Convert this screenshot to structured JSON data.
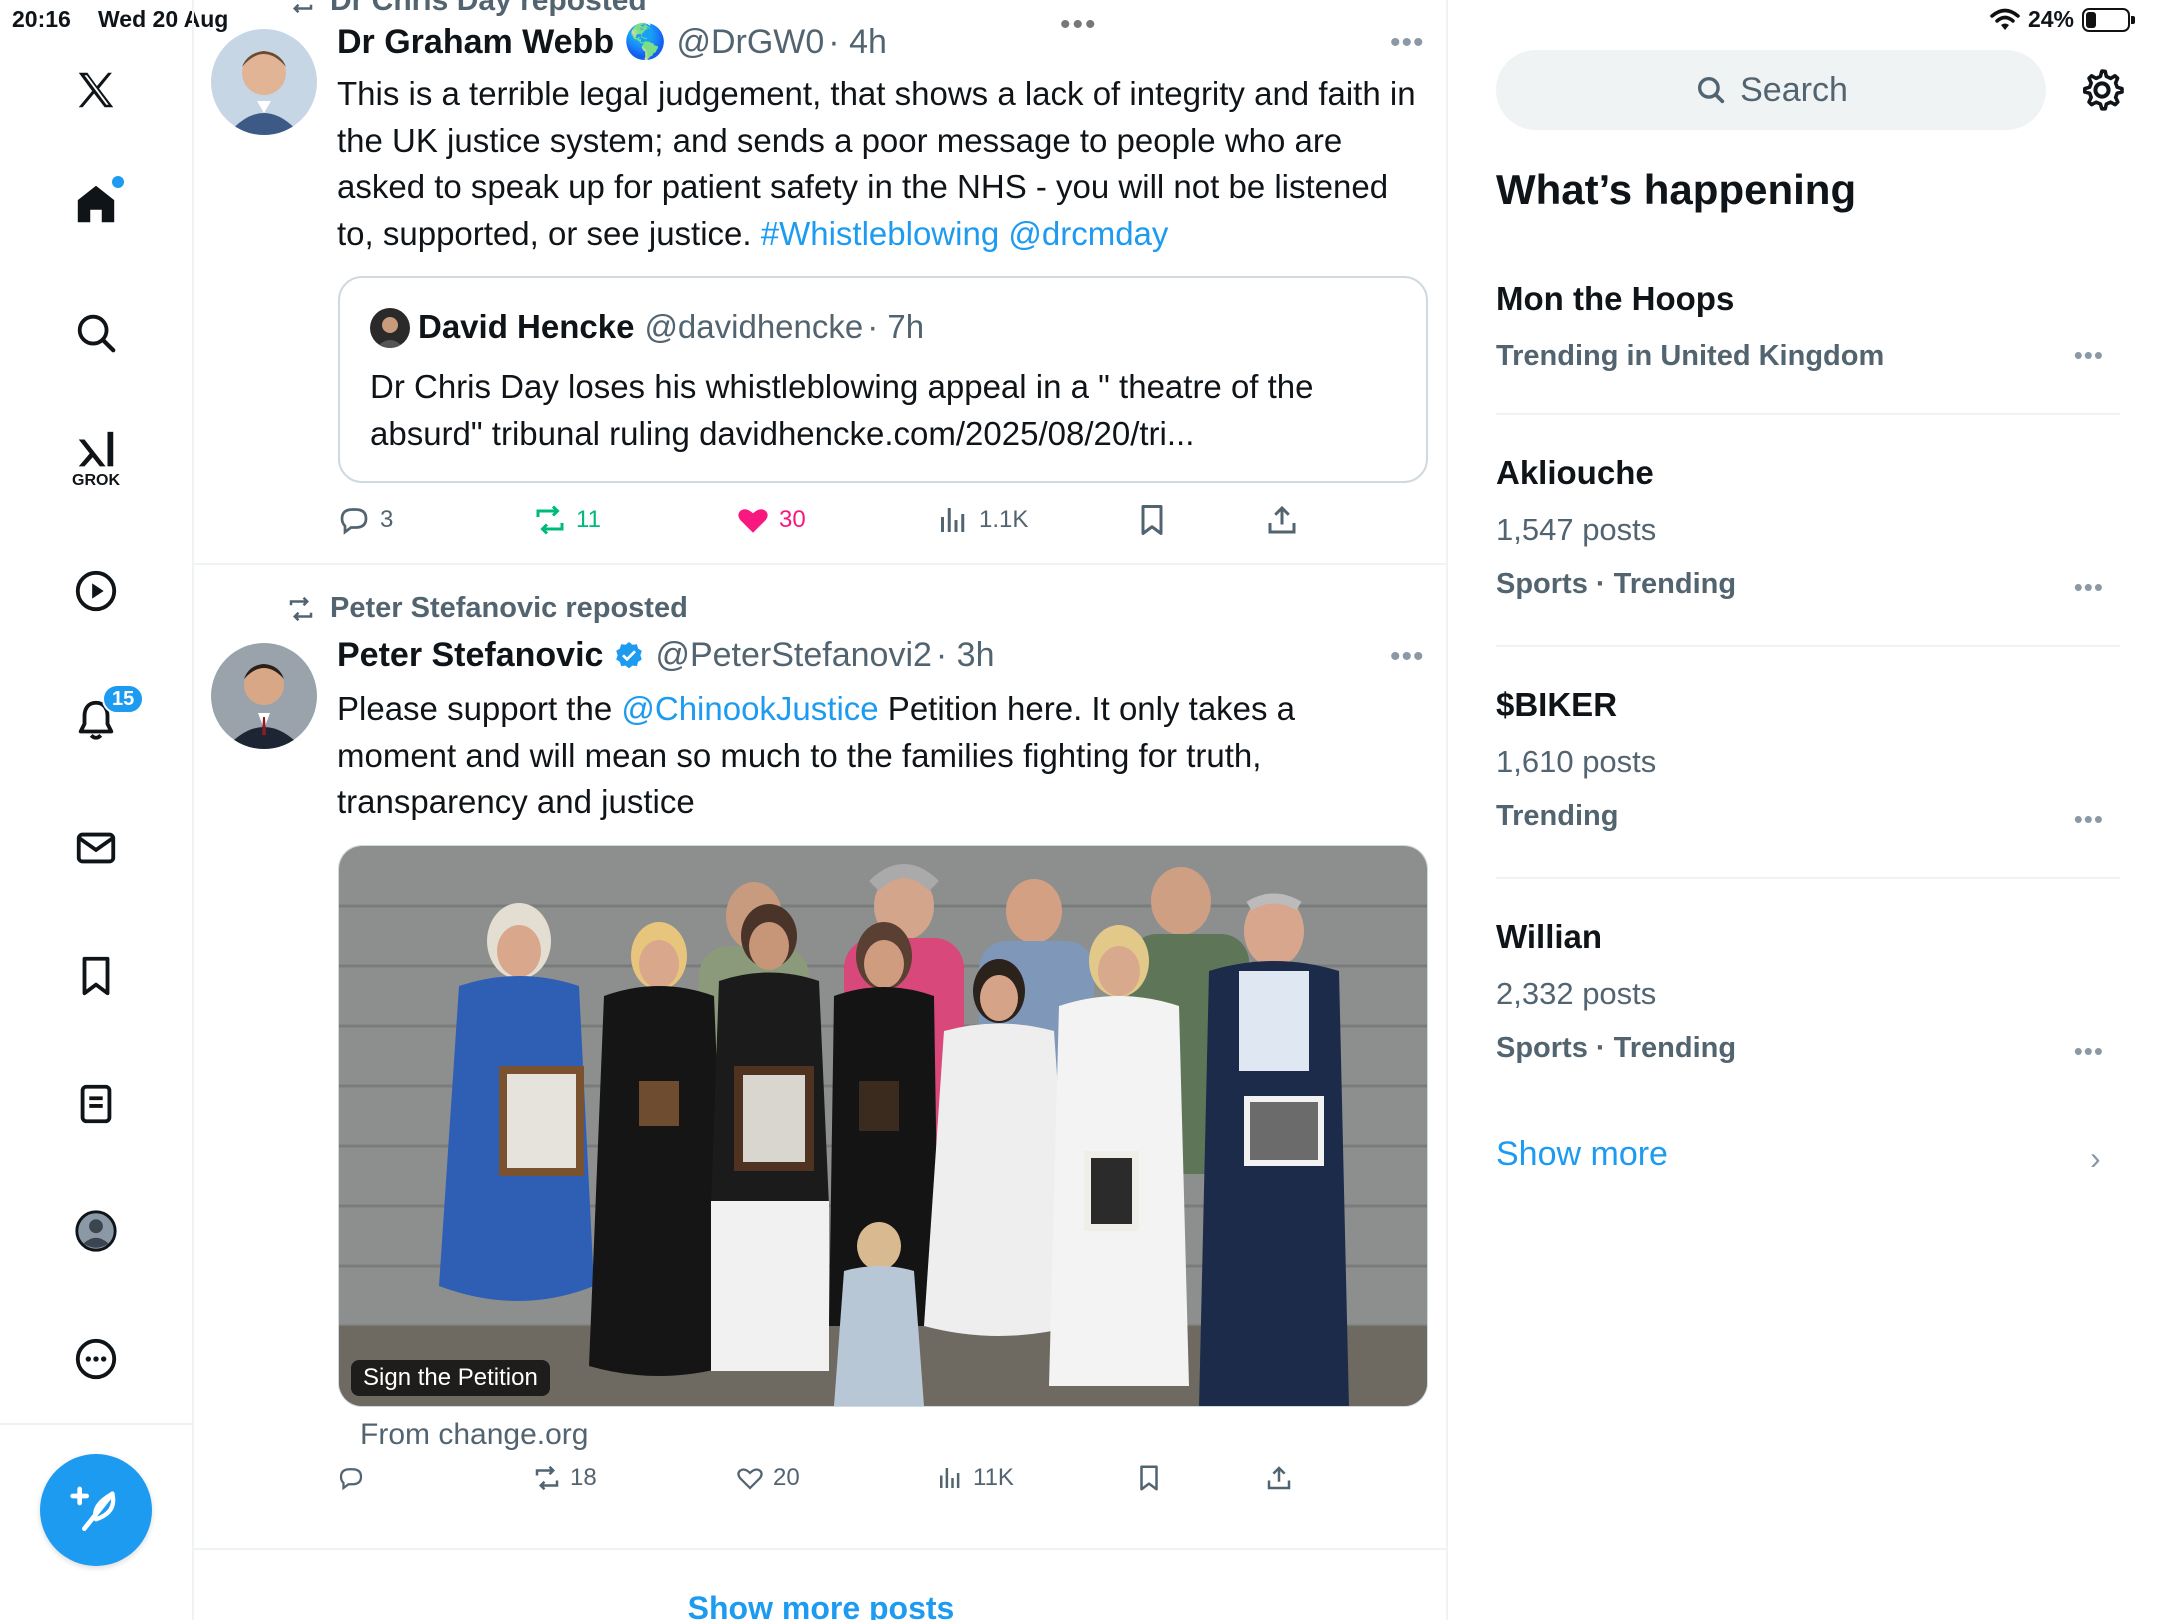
{
  "status_bar": {
    "time": "20:16",
    "date": "Wed 20 Aug",
    "battery": "24%"
  },
  "nav": {
    "grok_label": "GROK",
    "notification_count": "15"
  },
  "feed": {
    "top_repost_label": "Dr Chris Day reposted",
    "tweet1": {
      "name": "Dr Graham Webb",
      "emoji": "🌎",
      "handle": "@DrGW0",
      "time": "· 4h",
      "text_plain": "This is a terrible legal judgement, that shows a lack of integrity and faith in the UK justice system; and sends a poor message to people who are asked to speak up for patient safety in the NHS - you will not be listened to, supported, or see justice. ",
      "hashtag": "#Whistleblowing",
      "mention": "@drcmday",
      "quote": {
        "name": "David Hencke",
        "handle": "@davidhencke",
        "time": "· 7h",
        "text": "Dr Chris Day loses his whistleblowing appeal in a \" theatre of the absurd\" tribunal ruling davidhencke.com/2025/08/20/tri..."
      },
      "replies": "3",
      "reposts": "11",
      "likes": "30",
      "views": "1.1K"
    },
    "tweet2": {
      "reposted_by": "Peter Stefanovic reposted",
      "name": "Peter Stefanovic",
      "handle": "@PeterStefanovi2",
      "time": "· 3h",
      "text_before": "Please support the ",
      "mention": "@ChinookJustice",
      "text_after": " Petition here. It only takes a moment and will mean so much to the families fighting for truth, transparency and justice",
      "media_caption": "Sign the Petition",
      "source": "From change.org",
      "replies": "",
      "reposts": "18",
      "likes": "20",
      "views": "11K"
    },
    "show_more_posts": "Show more posts"
  },
  "sidebar": {
    "search_placeholder": "Search",
    "title": "What’s happening",
    "trends": [
      {
        "name": "Mon the Hoops",
        "posts": "",
        "meta": "Trending in United Kingdom"
      },
      {
        "name": "Akliouche",
        "posts": "1,547 posts",
        "meta": "Sports · Trending"
      },
      {
        "name": "$BIKER",
        "posts": "1,610 posts",
        "meta": "Trending"
      },
      {
        "name": "Willian",
        "posts": "2,332 posts",
        "meta": "Sports · Trending"
      }
    ],
    "show_more": "Show more"
  },
  "colors": {
    "accent": "#1d9bf0",
    "repost": "#00ba7c",
    "like": "#f91880",
    "muted": "#536471"
  }
}
